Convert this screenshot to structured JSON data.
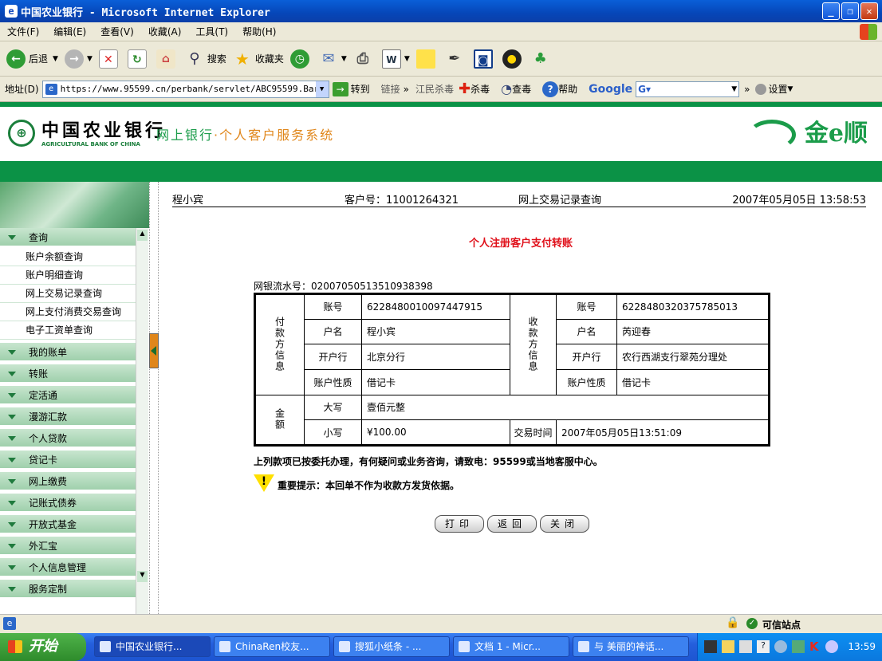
{
  "window": {
    "title": "中国农业银行 - Microsoft Internet Explorer"
  },
  "menu": [
    "文件(F)",
    "编辑(E)",
    "查看(V)",
    "收藏(A)",
    "工具(T)",
    "帮助(H)"
  ],
  "toolbar": {
    "back": "后退",
    "search": "搜索",
    "favorites": "收藏夹"
  },
  "address": {
    "label": "地址(D)",
    "url": "https://www.95599.cn/perbank/servlet/ABC95599.Bar",
    "go": "转到",
    "links": "链接",
    "jiangmin": "江民杀毒",
    "kill": "杀毒",
    "check": "查毒",
    "help": "帮助",
    "google": "Google",
    "settings": "设置"
  },
  "bank": {
    "name": "中国农业银行",
    "name_en": "AGRICULTURAL BANK OF CHINA",
    "system_prefix": "网上银行",
    "system_dot": "·",
    "system_name": "个人客户服务系统",
    "brand": "金e顺"
  },
  "nav": {
    "query": "查询",
    "sub": [
      "账户余额查询",
      "账户明细查询",
      "网上交易记录查询",
      "网上支付消费交易查询",
      "电子工资单查询"
    ],
    "categories": [
      "我的账单",
      "转账",
      "定活通",
      "漫游汇款",
      "个人贷款",
      "贷记卡",
      "网上缴费",
      "记账式债券",
      "开放式基金",
      "外汇宝",
      "个人信息管理",
      "服务定制"
    ]
  },
  "header": {
    "customer_name": "程小宾",
    "customer_no": "客户号：11001264321",
    "page": "网上交易记录查询",
    "datetime": "2007年05月05日 13:58:53"
  },
  "receipt": {
    "title": "个人注册客户支付转账",
    "serial": "网银流水号：020070505135109383​98",
    "payer_label": "付款方信息",
    "payee_label": "收款方信息",
    "amount_label": "金额",
    "account_label": "账号",
    "name_label": "户名",
    "bank_label": "开户行",
    "type_label": "账户性质",
    "payer_account": "6228480010097447915",
    "payer_name": "程小宾",
    "payer_bank": "北京分行",
    "payer_type": "借记卡",
    "payee_account": "6228480320375785013",
    "payee_name": "芮迎春",
    "payee_bank": "农行西湖支行翠苑分理处",
    "payee_type": "借记卡",
    "upper_label": "大写",
    "upper_value": "壹佰元整",
    "lower_label": "小写",
    "lower_value": "¥100.00",
    "time_label": "交易时间",
    "time_value": "2007年05月05日13:51:09"
  },
  "notes": {
    "note1": "上列款项已按委托办理，有何疑问或业务咨询，请致电：95599或当地客服中心。",
    "note2": "重要提示：本回单不作为收款方发货依据。"
  },
  "buttons": {
    "print": "打印",
    "back": "返回",
    "close": "关闭"
  },
  "status": {
    "zone": "可信站点"
  },
  "taskbar": {
    "start": "开始",
    "tasks": [
      "中国农业银行...",
      "ChinaRen校友...",
      "搜狐小纸条 - ...",
      "文档 1 - Micr...",
      "与 美丽的神话..."
    ],
    "clock": "13:59"
  }
}
